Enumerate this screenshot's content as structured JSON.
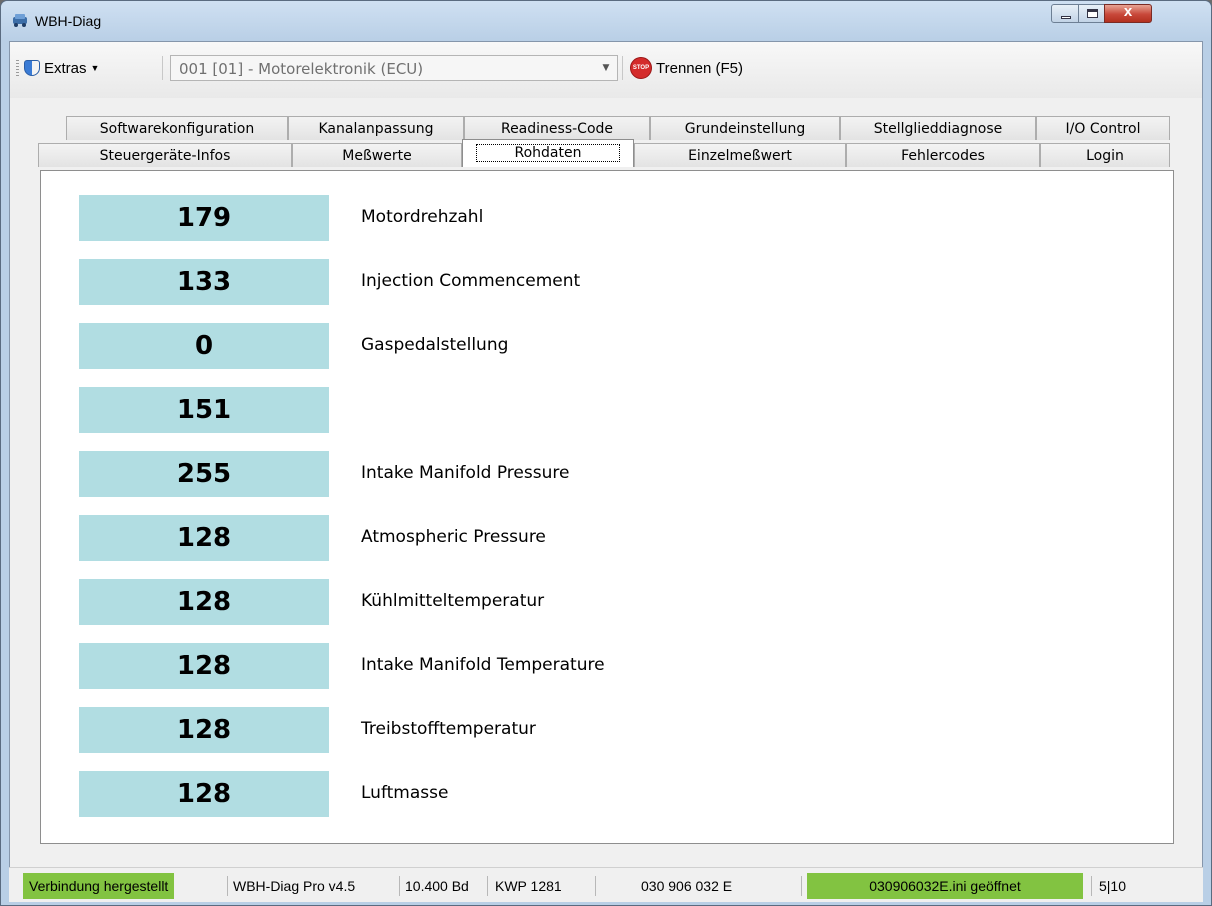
{
  "window": {
    "title": "WBH-Diag",
    "close_label": "x"
  },
  "toolbar": {
    "extras_label": "Extras",
    "ecu_selected": "001 [01] - Motorelektronik (ECU)",
    "disconnect_label": "Trennen (F5)",
    "stop_text": "STOP"
  },
  "tabs": {
    "row1": [
      "Softwarekonfiguration",
      "Kanalanpassung",
      "Readiness-Code",
      "Grundeinstellung",
      "Stellglieddiagnose",
      "I/O Control"
    ],
    "row2": [
      "Steuergeräte-Infos",
      "Meßwerte",
      "Rohdaten",
      "Einzelmeßwert",
      "Fehlercodes",
      "Login"
    ],
    "active": "Rohdaten"
  },
  "rows": [
    {
      "value": "179",
      "label": "Motordrehzahl"
    },
    {
      "value": "133",
      "label": "Injection Commencement"
    },
    {
      "value": "0",
      "label": "Gaspedalstellung"
    },
    {
      "value": "151",
      "label": ""
    },
    {
      "value": "255",
      "label": "Intake Manifold Pressure"
    },
    {
      "value": "128",
      "label": "Atmospheric Pressure"
    },
    {
      "value": "128",
      "label": "Kühlmitteltemperatur"
    },
    {
      "value": "128",
      "label": "Intake Manifold Temperature"
    },
    {
      "value": "128",
      "label": "Treibstofftemperatur"
    },
    {
      "value": "128",
      "label": "Luftmasse"
    }
  ],
  "status": {
    "connection": "Verbindung hergestellt",
    "version": "WBH-Diag Pro v4.5",
    "baud": "10.400 Bd",
    "protocol": "KWP 1281",
    "part_number": "030 906 032 E",
    "ini": "030906032E.ini geöffnet",
    "page": "5|10"
  },
  "colors": {
    "value_bg": "#b1dde2",
    "status_ok": "#82c341"
  }
}
